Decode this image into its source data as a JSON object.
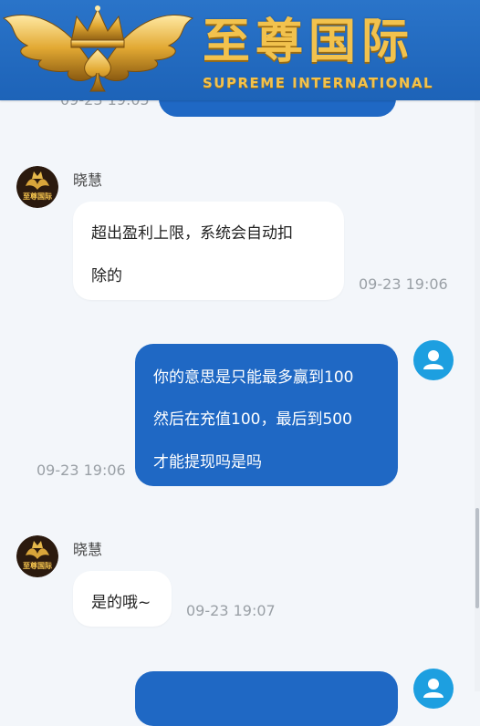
{
  "header": {
    "brand_title": "至尊国际",
    "brand_subtitle": "SUPREME INTERNATIONAL"
  },
  "messages": [
    {
      "side": "right",
      "time": "09-23 19:05",
      "partial": true
    },
    {
      "side": "left",
      "sender": "晓慧",
      "lines": [
        "超出盈利上限，系统会自动扣",
        "除的"
      ],
      "time": "09-23 19:06"
    },
    {
      "side": "right",
      "lines": [
        "你的意思是只能最多赢到100",
        "然后在充值100，最后到500",
        "才能提现吗是吗"
      ],
      "time": "09-23 19:06"
    },
    {
      "side": "left",
      "sender": "晓慧",
      "lines": [
        "是的哦~"
      ],
      "time": "09-23 19:07"
    },
    {
      "side": "right",
      "partial": true
    }
  ],
  "avatar_text": "至尊国际",
  "colors": {
    "header_bg": "#2a74c9",
    "brand_gold": "#f2c24d",
    "bubble_right": "#1f68c4",
    "bubble_left": "#ffffff",
    "user_avatar": "#1d9fe0",
    "page_bg": "#f3f6fa"
  },
  "icons": [
    "crown-wings-logo-icon",
    "user-avatar-icon"
  ]
}
